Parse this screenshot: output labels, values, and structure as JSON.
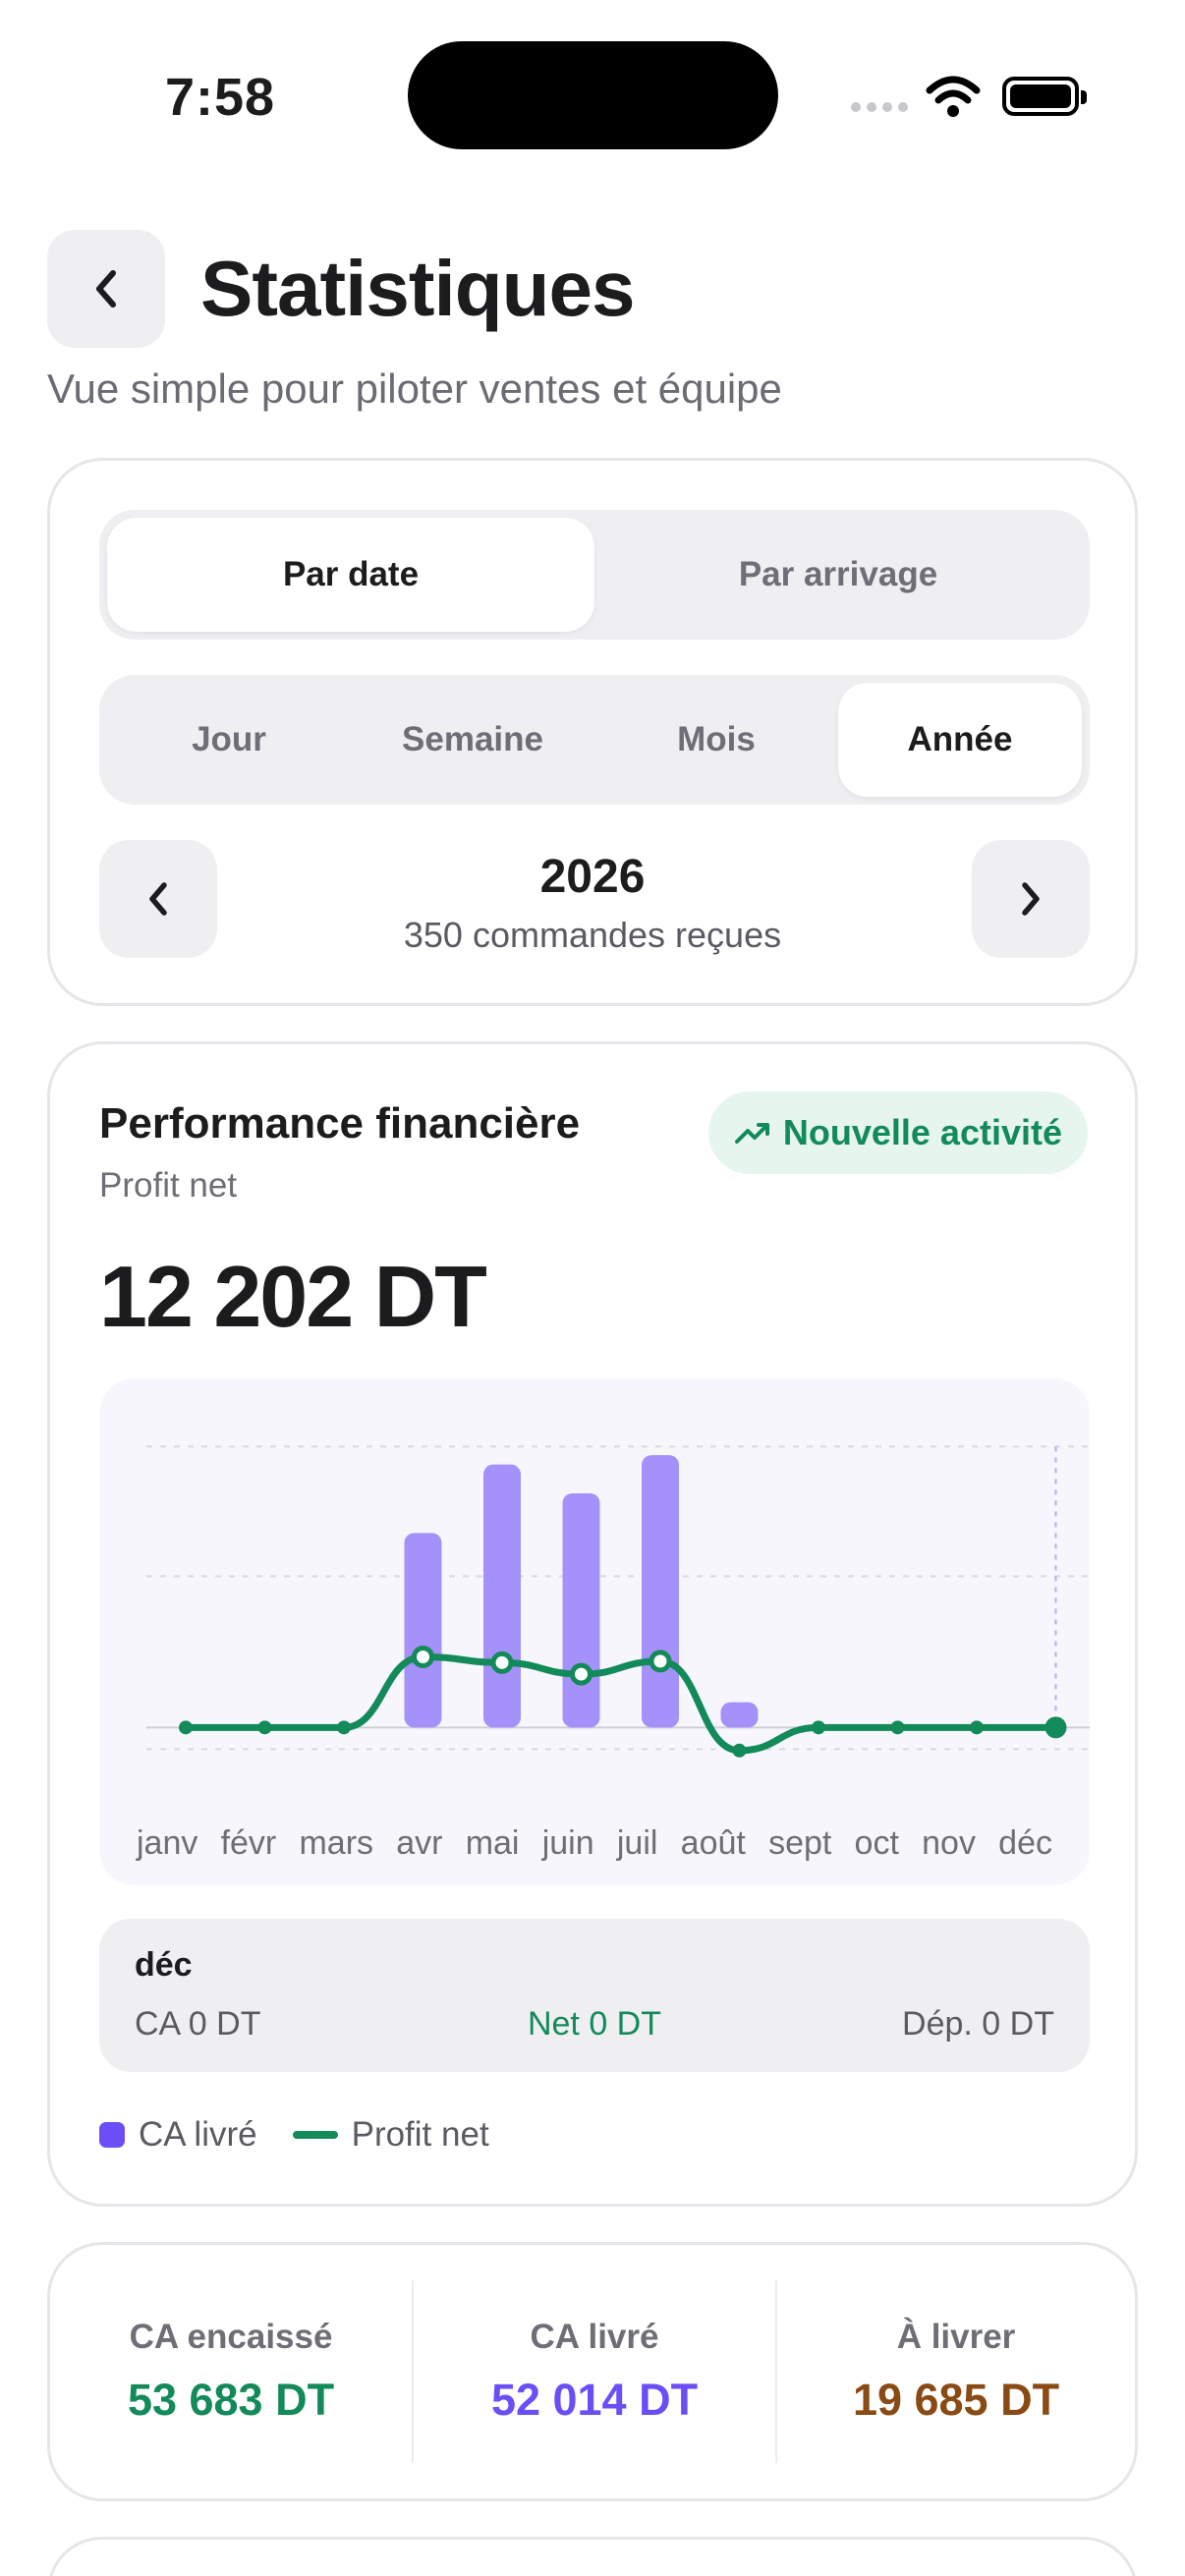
{
  "status_bar": {
    "time": "7:58"
  },
  "header": {
    "title": "Statistiques",
    "subtitle": "Vue simple pour piloter ventes et équipe"
  },
  "filters": {
    "mode_tabs": [
      "Par date",
      "Par arrivage"
    ],
    "mode_selected": "Par date",
    "granularity_tabs": [
      "Jour",
      "Semaine",
      "Mois",
      "Année"
    ],
    "granularity_selected": "Année",
    "period": {
      "label": "2026",
      "orders": "350 commandes reçues"
    }
  },
  "performance": {
    "title": "Performance financière",
    "subtitle": "Profit net",
    "badge": "Nouvelle activité",
    "value": "12 202 DT",
    "colors": {
      "bar": "#a591fa",
      "line": "#138a5a",
      "legend_bar": "#6b4ef6"
    }
  },
  "chart_data": {
    "type": "bar",
    "categories": [
      "janv",
      "févr",
      "mars",
      "avr",
      "mai",
      "juin",
      "juil",
      "août",
      "sept",
      "oct",
      "nov",
      "déc"
    ],
    "series": [
      {
        "name": "CA livré",
        "type": "bar",
        "values": [
          0,
          0,
          0,
          2700,
          3650,
          3250,
          3780,
          350,
          0,
          0,
          0,
          0
        ]
      },
      {
        "name": "Profit net",
        "type": "line",
        "values": [
          0,
          0,
          0,
          980,
          900,
          740,
          920,
          -320,
          0,
          0,
          0,
          0
        ]
      }
    ],
    "ylim": [
      -500,
      4000
    ],
    "grid": true,
    "highlighted_category": "déc"
  },
  "detail": {
    "month": "déc",
    "ca": "CA 0 DT",
    "net": "Net 0 DT",
    "dep": "Dép. 0 DT"
  },
  "legend": {
    "bar_label": "CA livré",
    "line_label": "Profit net"
  },
  "kpis": [
    {
      "label": "CA encaissé",
      "value": "53 683 DT",
      "color": "#138a5a"
    },
    {
      "label": "CA livré",
      "value": "52 014 DT",
      "color": "#6b4ef6"
    },
    {
      "label": "À livrer",
      "value": "19 685 DT",
      "color": "#8a4a14"
    }
  ]
}
